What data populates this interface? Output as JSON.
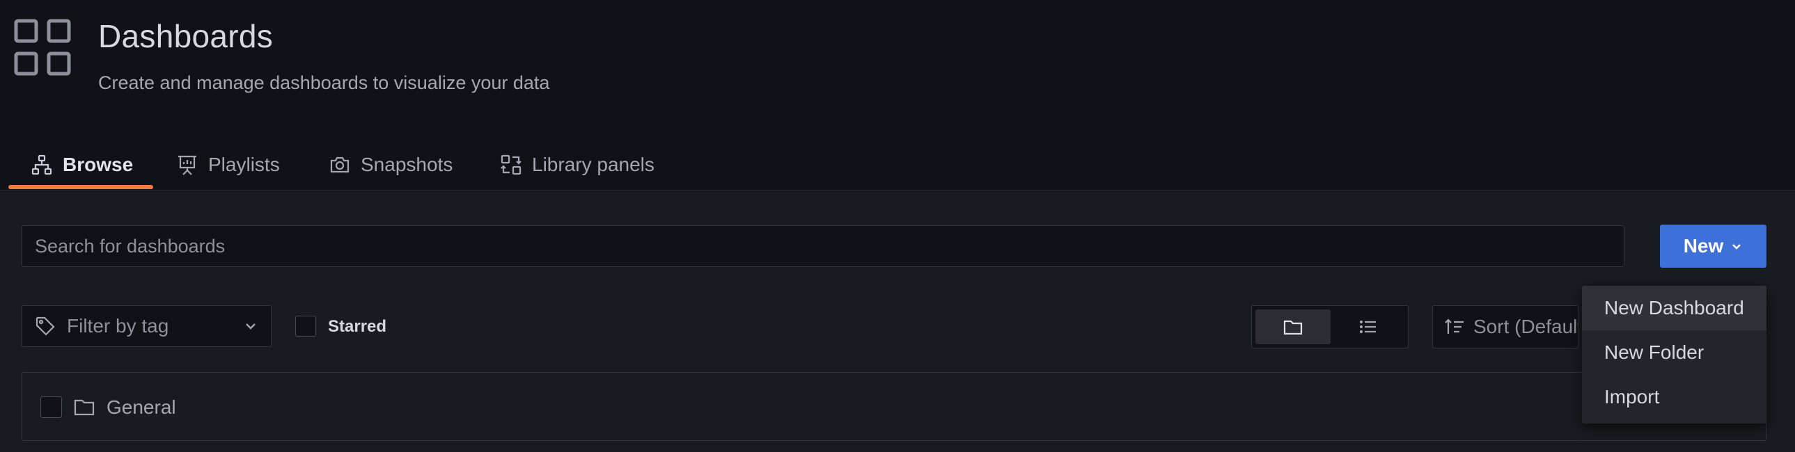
{
  "header": {
    "icon": "dashboards-grid-icon",
    "title": "Dashboards",
    "subtitle": "Create and manage dashboards to visualize your data"
  },
  "tabs": [
    {
      "label": "Browse",
      "icon": "sitemap-icon",
      "active": true
    },
    {
      "label": "Playlists",
      "icon": "presentation-icon",
      "active": false
    },
    {
      "label": "Snapshots",
      "icon": "camera-icon",
      "active": false
    },
    {
      "label": "Library panels",
      "icon": "library-panels-icon",
      "active": false
    }
  ],
  "search": {
    "placeholder": "Search for dashboards",
    "value": ""
  },
  "new_button": {
    "label": "New"
  },
  "filters": {
    "tag_filter_placeholder": "Filter by tag",
    "starred_label": "Starred",
    "sort_label": "Sort (Default A–Z)"
  },
  "folders": [
    {
      "name": "General"
    }
  ],
  "new_menu": {
    "items": [
      "New Dashboard",
      "New Folder",
      "Import"
    ]
  },
  "colors": {
    "accent": "#3d71d9",
    "active_tab_underline": "#ff7941",
    "background": "#181b1f",
    "header_background": "#111217"
  }
}
